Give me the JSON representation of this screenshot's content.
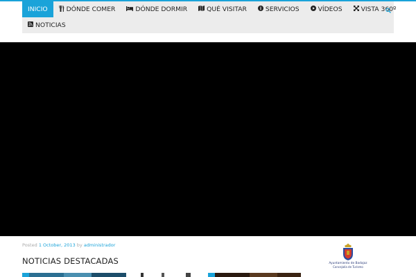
{
  "nav": {
    "items": [
      {
        "label": "INICIO",
        "icon": ""
      },
      {
        "label": "DÓNDE COMER",
        "icon": "cutlery-icon"
      },
      {
        "label": "DÓNDE DORMIR",
        "icon": "bed-icon"
      },
      {
        "label": "QUÉ VISITAR",
        "icon": "map-icon"
      },
      {
        "label": "SERVICIOS",
        "icon": "info-icon"
      },
      {
        "label": "VÍDEOS",
        "icon": "play-icon"
      },
      {
        "label": "VISTA 360º",
        "icon": "arrows-icon"
      }
    ],
    "row2": [
      {
        "label": "NOTICIAS",
        "icon": "rss-icon"
      }
    ],
    "search_icon": "search-icon",
    "accent": "#1aa3d9"
  },
  "post": {
    "posted_prefix": "Posted",
    "date": "1 October, 2013",
    "by": "by",
    "author": "administrador"
  },
  "section": {
    "title": "NOTICIAS DESTACADAS"
  },
  "logo": {
    "name": "Ayuntamiento de Badajoz",
    "sub": "Concejalía de Turismo"
  }
}
